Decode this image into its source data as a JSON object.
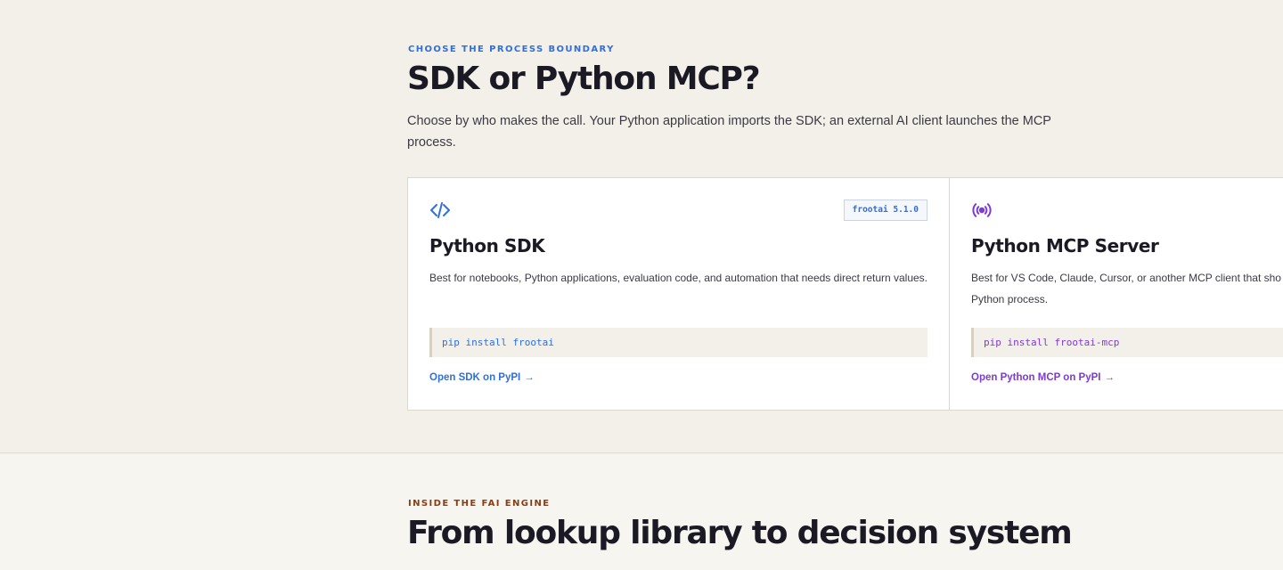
{
  "boundary": {
    "eyebrow": "CHOOSE THE PROCESS BOUNDARY",
    "title": "SDK or Python MCP?",
    "lead": "Choose by who makes the call. Your Python application imports the SDK; an external AI client launches the MCP process."
  },
  "cards": [
    {
      "icon": "code-icon",
      "accent": "#2f6fde",
      "badge": "frootai 5.1.0",
      "title": "Python SDK",
      "description": "Best for notebooks, Python applications, evaluation code, and automation that needs direct return values.",
      "install": "pip install frootai",
      "link": "Open SDK on PyPI",
      "arrow": "→"
    },
    {
      "icon": "broadcast-icon",
      "accent": "#7d3bd3",
      "title": "Python MCP Server",
      "description": "Best for VS Code, Claude, Cursor, or another MCP client that sho",
      "description_2": "Python process.",
      "install": "pip install frootai-mcp",
      "link": "Open Python MCP on PyPI",
      "arrow": "→"
    }
  ],
  "engine": {
    "eyebrow": "INSIDE THE FAI ENGINE",
    "title": "From lookup library to decision system"
  }
}
